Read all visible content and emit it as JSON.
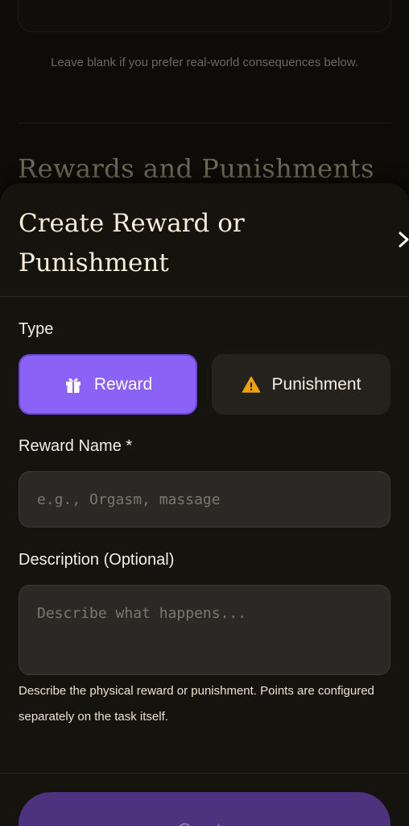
{
  "background": {
    "hint": "Leave blank if you prefer real-world consequences below.",
    "section_title": "Rewards and Punishments"
  },
  "modal": {
    "title": "Create Reward or Punishment",
    "close_icon": "chevron-right-icon",
    "type_label": "Type",
    "type_options": [
      {
        "label": "Reward",
        "icon": "gift-icon",
        "selected": true
      },
      {
        "label": "Punishment",
        "icon": "warning-icon",
        "selected": false
      }
    ],
    "name_label": "Reward Name *",
    "name_placeholder": "e.g., Orgasm, massage",
    "name_value": "",
    "description_label": "Description (Optional)",
    "description_placeholder": "Describe what happens...",
    "description_value": "",
    "helper_text": "Describe the physical reward or punishment. Points are configured separately on the task itself.",
    "create_label": "Create"
  },
  "colors": {
    "accent": "#8b62f6",
    "warning": "#f2a012",
    "sheet_bg": "#14130d"
  }
}
